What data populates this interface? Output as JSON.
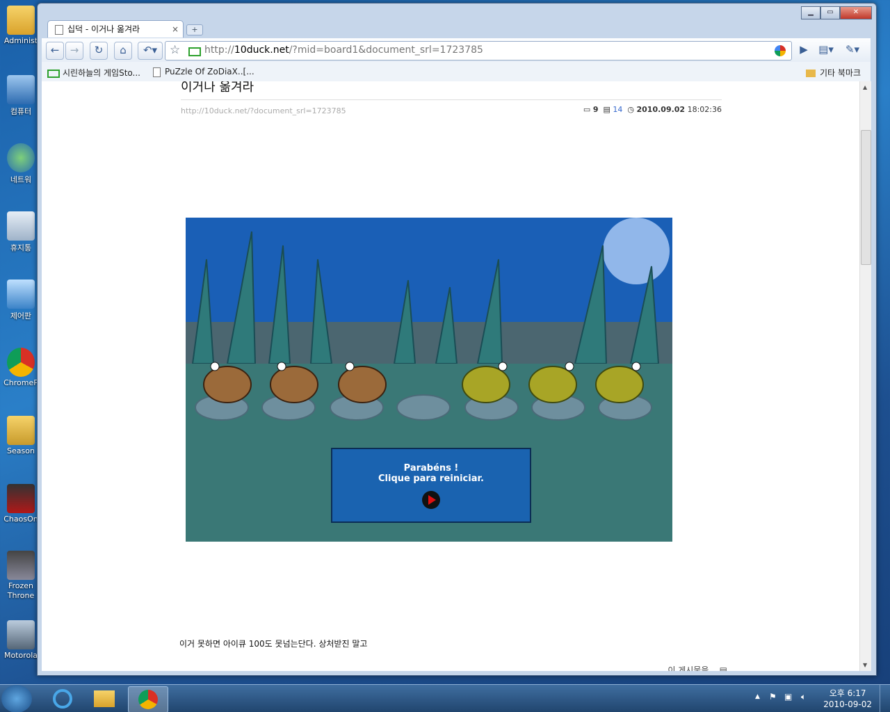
{
  "desktop": {
    "icons": [
      "Administ",
      "컴퓨터",
      "네트워",
      "휴지통",
      "제어판",
      "ChromeP",
      "Season",
      "ChaosOn",
      "Frozen Throne",
      "Motorola"
    ]
  },
  "window": {
    "tab_title": "십덕 - 이거나 옮겨라",
    "url_prefix": "http://",
    "url_domain": "10duck.net",
    "url_path": "/?mid=board1&document_srl=1723785"
  },
  "bookmarks": {
    "items": [
      "시린하늘의 게임Sto...",
      "PuZzle Of ZoDiaX..[..."
    ],
    "other": "기타 북마크"
  },
  "post": {
    "title": "이거나 옮겨라",
    "link": "http://10duck.net/?document_srl=1723785",
    "comments": "9",
    "trackbacks": "14",
    "date": "2010.09.02",
    "time": "18:02:36",
    "body": "이거 못하면 아이큐 100도 못넘는단다. 상처받진 말고",
    "footer": "이 게시물을..."
  },
  "game": {
    "msg_line1": "Parabéns !",
    "msg_line2": "Clique para reiniciar."
  },
  "taskbar": {
    "time": "오후 6:17",
    "date": "2010-09-02"
  }
}
